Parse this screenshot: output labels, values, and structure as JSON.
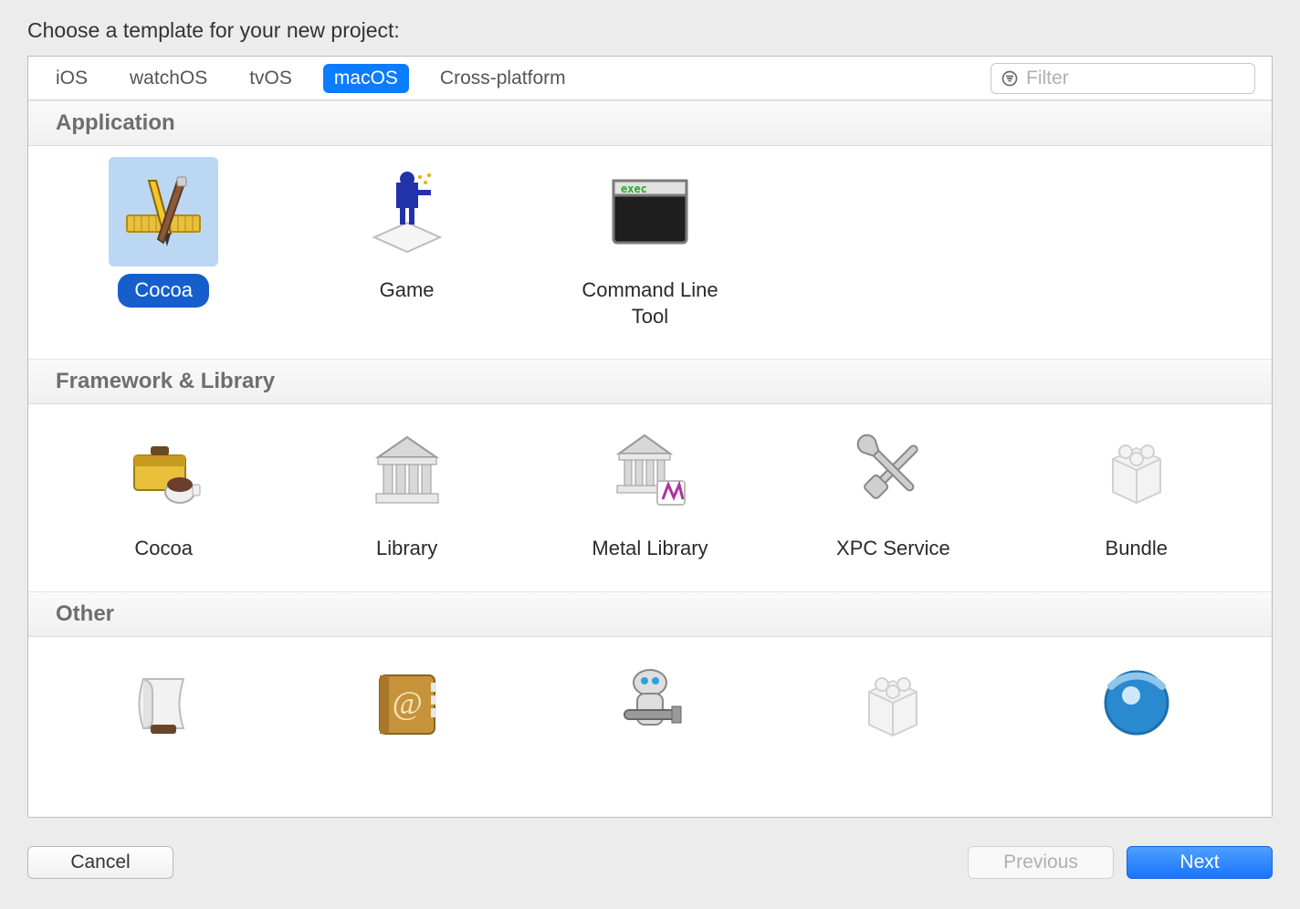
{
  "title": "Choose a template for your new project:",
  "tabs": {
    "items": [
      "iOS",
      "watchOS",
      "tvOS",
      "macOS",
      "Cross-platform"
    ],
    "selected_index": 3
  },
  "filter": {
    "placeholder": "Filter",
    "value": ""
  },
  "sections": [
    {
      "title": "Application",
      "items": [
        {
          "label": "Cocoa",
          "icon": "app-cocoa-icon",
          "selected": true
        },
        {
          "label": "Game",
          "icon": "game-icon",
          "selected": false
        },
        {
          "label": "Command Line Tool",
          "icon": "terminal-icon",
          "selected": false
        }
      ]
    },
    {
      "title": "Framework & Library",
      "items": [
        {
          "label": "Cocoa",
          "icon": "toolbox-icon",
          "selected": false
        },
        {
          "label": "Library",
          "icon": "library-icon",
          "selected": false
        },
        {
          "label": "Metal Library",
          "icon": "metal-library-icon",
          "selected": false
        },
        {
          "label": "XPC Service",
          "icon": "tools-icon",
          "selected": false
        },
        {
          "label": "Bundle",
          "icon": "bundle-icon",
          "selected": false
        }
      ]
    },
    {
      "title": "Other",
      "items": [
        {
          "label": "",
          "icon": "script-icon",
          "selected": false
        },
        {
          "label": "",
          "icon": "address-book-icon",
          "selected": false
        },
        {
          "label": "",
          "icon": "automator-icon",
          "selected": false
        },
        {
          "label": "",
          "icon": "bundle-icon",
          "selected": false
        },
        {
          "label": "",
          "icon": "sphere-icon",
          "selected": false
        }
      ]
    }
  ],
  "buttons": {
    "cancel": "Cancel",
    "previous": "Previous",
    "next": "Next",
    "previous_enabled": false
  }
}
